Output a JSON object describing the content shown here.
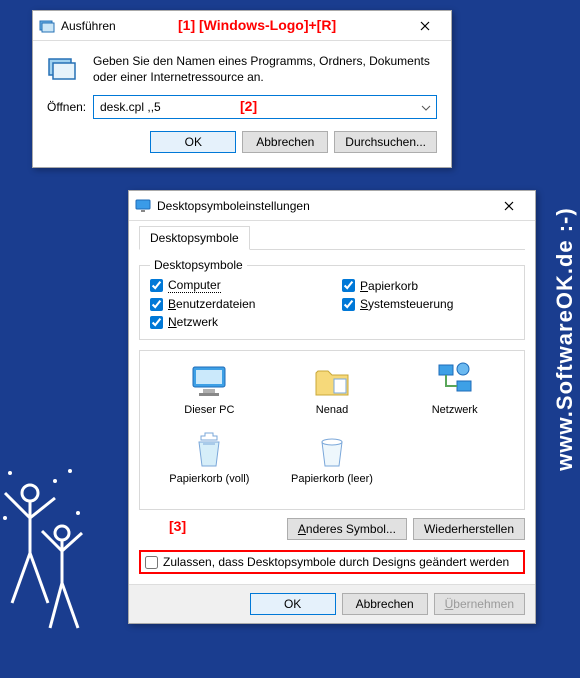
{
  "annotations": {
    "a1": "[1]  [Windows-Logo]+[R]",
    "a2": "[2]",
    "a3": "[3]"
  },
  "watermark": {
    "side": "www.SoftwareOK.de :-)",
    "inline": "www.SoftwareOK.de :-)"
  },
  "run": {
    "title": "Ausführen",
    "description": "Geben Sie den Namen eines Programms, Ordners, Dokuments oder einer Internetressource an.",
    "open_label": "Öffnen:",
    "value": "desk.cpl ,,5",
    "ok": "OK",
    "cancel": "Abbrechen",
    "browse": "Durchsuchen..."
  },
  "dsk": {
    "title": "Desktopsymboleinstellungen",
    "tab": "Desktopsymbole",
    "legend": "Desktopsymbole",
    "checks": {
      "computer": "Computer",
      "papierkorb": "Papierkorb",
      "benutzer": "Benutzerdateien",
      "systemsteuerung": "Systemsteuerung",
      "netzwerk": "Netzwerk"
    },
    "icons": {
      "dieserpc": "Dieser PC",
      "nenad": "Nenad",
      "netzwerk": "Netzwerk",
      "papierkorb_voll": "Papierkorb (voll)",
      "papierkorb_leer": "Papierkorb (leer)"
    },
    "change_icon": "Anderes Symbol...",
    "restore": "Wiederherstellen",
    "allow_themes": "Zulassen, dass Desktopsymbole durch Designs geändert werden",
    "ok": "OK",
    "cancel": "Abbrechen",
    "apply": "Übernehmen"
  }
}
